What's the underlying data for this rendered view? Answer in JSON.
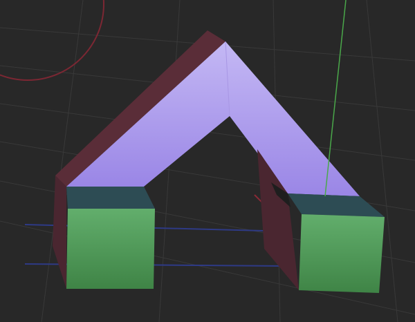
{
  "viewport": {
    "background": "#282828",
    "grid_color": "#3a3a3a",
    "x_axis_color": "#8a2a36",
    "y_axis_color": "#3040a0",
    "z_axis_color": "#4aa84a"
  },
  "scene": {
    "object": "arch-mesh",
    "roof_top_color": "#b8a6f0",
    "roof_shadow_color": "#8c78d8",
    "roof_side_color": "#5a2d38",
    "left_leg_front_color": "#55a860",
    "left_leg_top_color": "#2d4c54",
    "left_leg_side_color": "#4a2630",
    "right_leg_front_color": "#55a860",
    "right_leg_top_color": "#2d4c54",
    "right_leg_side_color": "#4a2630"
  }
}
